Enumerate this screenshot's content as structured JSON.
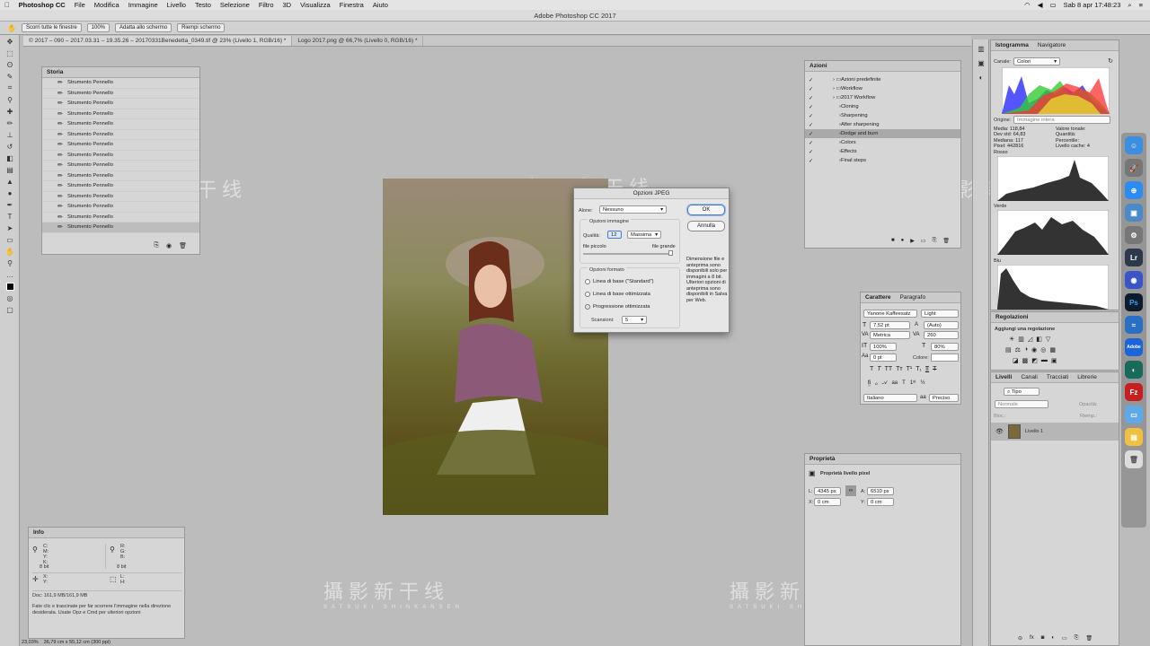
{
  "menubar": {
    "app": "Photoshop CC",
    "items": [
      "File",
      "Modifica",
      "Immagine",
      "Livello",
      "Testo",
      "Selezione",
      "Filtro",
      "3D",
      "Visualizza",
      "Finestra",
      "Aiuto"
    ],
    "datetime": "Sab 8 apr  17:48:23"
  },
  "window_title": "Adobe Photoshop CC 2017",
  "options": {
    "scroll_all": "Scorri tutte le finestre",
    "zoom_100": "100%",
    "fit_screen": "Adatta allo schermo",
    "fill_screen": "Riempi schermo"
  },
  "tabs": [
    "© 2017 – 090 – 2017.03.31 – 19.35.26 – 20170331Benedetta_0349.tif @ 23% (Livello 1, RGB/16) *",
    "Logo 2017.png @ 66,7% (Livello 0, RGB/16) *"
  ],
  "history": {
    "title": "Storia",
    "item_label": "Strumento Pennello",
    "count": 15
  },
  "actions": {
    "title": "Azioni",
    "items": [
      {
        "label": "Azioni predefinite",
        "level": 0
      },
      {
        "label": "Workflow",
        "level": 0
      },
      {
        "label": "2017 Workflow",
        "level": 0
      },
      {
        "label": "Cloning",
        "level": 1
      },
      {
        "label": "Sharpening",
        "level": 1
      },
      {
        "label": "After sharpening",
        "level": 1
      },
      {
        "label": "Dodge and burn",
        "level": 1
      },
      {
        "label": "Colors",
        "level": 1
      },
      {
        "label": "Effects",
        "level": 1
      },
      {
        "label": "Final steps",
        "level": 1
      }
    ]
  },
  "info": {
    "title": "Info",
    "cmyk": "C:\nM:\nY:\nK:",
    "rgb": "R:\nG:\nB:",
    "bits": "8 bit",
    "xy": "X:\nY:",
    "lh": "L:\nH:",
    "doc": "Doc: 161,9 MB/161,9 MB",
    "hint": "Fate clic e trascinate per far scorrere l'immagine nella direzione desiderata. Usate Opz e Cmd per ulteriori opzioni"
  },
  "status": {
    "zoom": "23,03%",
    "size": "36,79 cm x 55,12 cm (300 ppi)"
  },
  "dialog": {
    "title": "Opzioni JPEG",
    "matte_label": "Alone:",
    "matte_value": "Nessuno",
    "image_options": "Opzioni immagine",
    "quality_label": "Qualità:",
    "quality_value": "12",
    "quality_preset": "Massima",
    "small_file": "file piccolo",
    "large_file": "file grande",
    "format_options": "Opzioni formato",
    "baseline_standard": "Linea di base (\"Standard\")",
    "baseline_optimized": "Linea di base ottimizzata",
    "progressive": "Progressione ottimizzata",
    "scans_label": "Scansioni:",
    "scans_value": "5",
    "ok": "OK",
    "cancel": "Annulla",
    "note": "Dimensione file e anteprima sono disponibili solo per immagini a 8 bit. Ulteriori opzioni di anteprima sono disponibili in Salva per Web."
  },
  "histogram": {
    "tab1": "Istogramma",
    "tab2": "Navigatore",
    "channel_label": "Canale:",
    "channel_value": "Colori",
    "origin_label": "Origine:",
    "origin_value": "Immagine intera",
    "stats_left": "Media: 118,84\nDev std: 64,83\nMediana: 117\nPixel: 442816",
    "stats_right": "Valore tonale:\nQuantità:\nPercentile:\nLivello cache: 4",
    "red": "Rosso",
    "green": "Verde",
    "blue": "Blu"
  },
  "character": {
    "tab1": "Carattere",
    "tab2": "Paragrafo",
    "font": "Yanone Kaffeesatz",
    "style": "Light",
    "size": "7,52 pt",
    "leading": "(Auto)",
    "kerning": "Metrica",
    "tracking": "260",
    "vscale": "100%",
    "hscale": "80%",
    "baseline": "0 pt",
    "color_label": "Colore:",
    "language": "Italiano",
    "antialias": "Preciso"
  },
  "adjustments": {
    "title": "Regolazioni",
    "subtitle": "Aggiungi una regolazione"
  },
  "layers": {
    "tabs": [
      "Livelli",
      "Canali",
      "Tracciati",
      "Librerie"
    ],
    "kind": "Tipo",
    "blend": "Normale",
    "opacity_label": "Opacità:",
    "fill_label": "Riemp.:",
    "lock_label": "Bloc.:",
    "layer_name": "Livello 1"
  },
  "properties": {
    "title": "Proprietà",
    "subtitle": "Proprietà livello pixel",
    "w_label": "L:",
    "w": "4345 px",
    "h_label": "A:",
    "h": "6510 px",
    "x_label": "X:",
    "x": "0 cm",
    "y_label": "Y:",
    "y": "0 cm"
  },
  "watermark": {
    "cn": "攝影新干线",
    "en": "SATSUKI SHINKANSEN"
  },
  "dock": [
    "Finder",
    "Launchpad",
    "Safari",
    "Preview",
    "Prefs",
    "Lr",
    "Siri",
    "Ps",
    "Photos",
    "Adobe",
    "Sync",
    "FileZilla",
    "Folder",
    "Notes",
    "Trash"
  ]
}
